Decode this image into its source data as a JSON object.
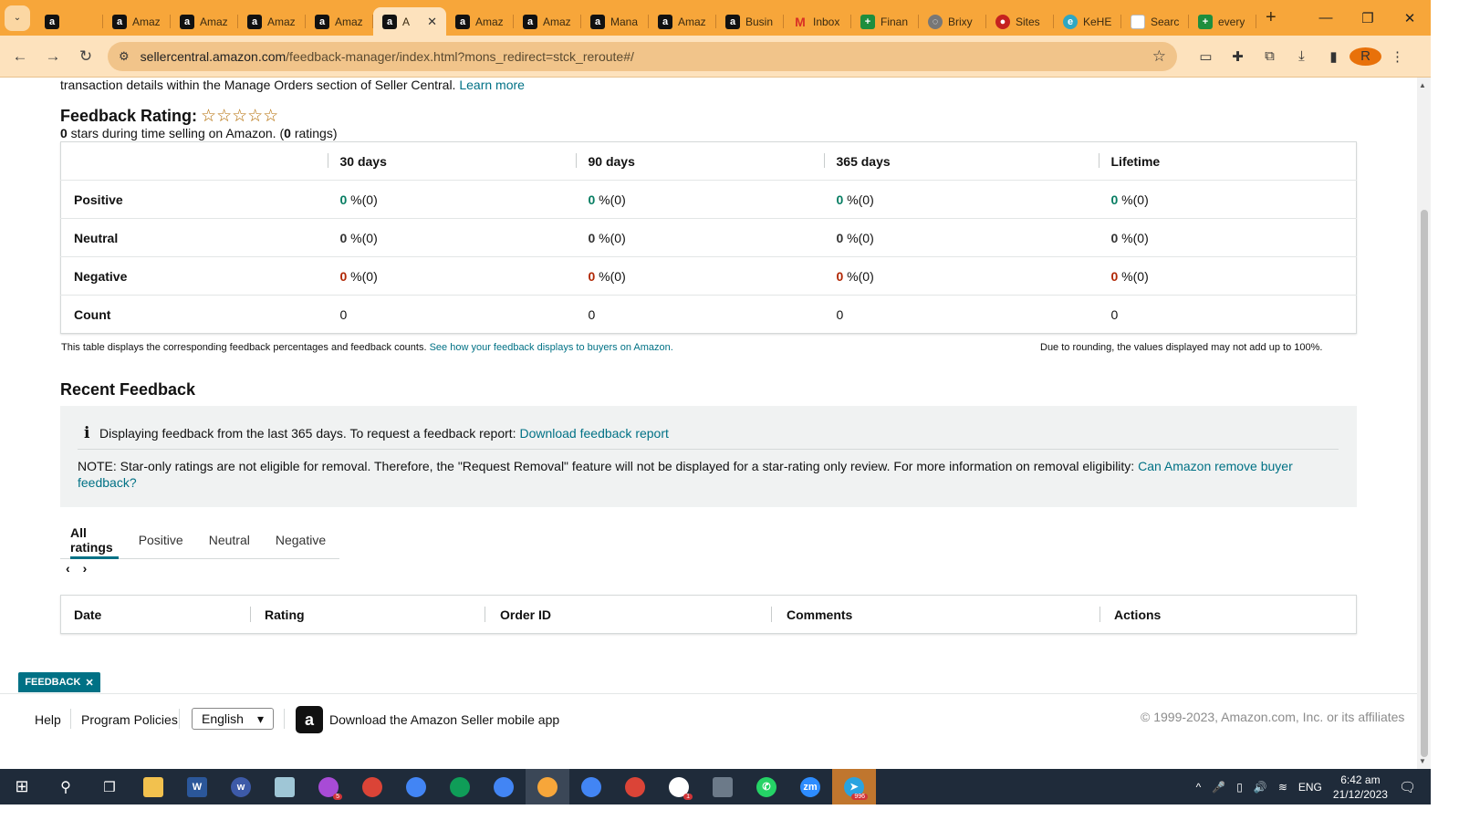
{
  "browser": {
    "tabs": [
      {
        "title": "",
        "icon": "amazon-icon",
        "active": false
      },
      {
        "title": "Amaz",
        "icon": "amazon-icon",
        "active": false
      },
      {
        "title": "Amaz",
        "icon": "amazon-icon",
        "active": false
      },
      {
        "title": "Amaz",
        "icon": "amazon-icon",
        "active": false
      },
      {
        "title": "Amaz",
        "icon": "amazon-icon",
        "active": false
      },
      {
        "title": "A",
        "icon": "amazon-icon",
        "active": true
      },
      {
        "title": "Amaz",
        "icon": "amazon-icon",
        "active": false
      },
      {
        "title": "Amaz",
        "icon": "amazon-icon",
        "active": false
      },
      {
        "title": "Mana",
        "icon": "amazon-icon",
        "active": false
      },
      {
        "title": "Amaz",
        "icon": "amazon-icon",
        "active": false
      },
      {
        "title": "Busin",
        "icon": "amazon-icon",
        "active": false
      },
      {
        "title": "Inbox",
        "icon": "gmail-icon",
        "active": false
      },
      {
        "title": "Finan",
        "icon": "sheets-icon",
        "active": false
      },
      {
        "title": "Brixy",
        "icon": "globe-icon",
        "active": false
      },
      {
        "title": "Sites",
        "icon": "site-icon",
        "active": false
      },
      {
        "title": "KeHE",
        "icon": "edge-icon",
        "active": false
      },
      {
        "title": "Searc",
        "icon": "page-icon",
        "active": false
      },
      {
        "title": "every",
        "icon": "sheets-icon",
        "active": false
      }
    ],
    "url_host": "sellercentral.amazon.com",
    "url_path": "/feedback-manager/index.html?mons_redirect=stck_reroute#/",
    "profile_initial": "R"
  },
  "intro": {
    "text": "transaction details within the Manage Orders section of Seller Central. ",
    "link": "Learn more"
  },
  "rating": {
    "title": "Feedback Rating:",
    "stars": "☆☆☆☆☆",
    "summary_prefix": "0",
    "summary_mid": " stars during time selling on Amazon. (",
    "summary_count": "0",
    "summary_suffix": " ratings)"
  },
  "feedback_table": {
    "headers": [
      "",
      "30 days",
      "90 days",
      "365 days",
      "Lifetime"
    ],
    "rows": [
      {
        "label": "Positive",
        "cells": [
          {
            "v": "0",
            "u": " %(0)"
          },
          {
            "v": "0",
            "u": " %(0)"
          },
          {
            "v": "0",
            "u": " %(0)"
          },
          {
            "v": "0",
            "u": " %(0)"
          }
        ]
      },
      {
        "label": "Neutral",
        "cells": [
          {
            "v": "0",
            "u": " %(0)"
          },
          {
            "v": "0",
            "u": " %(0)"
          },
          {
            "v": "0",
            "u": " %(0)"
          },
          {
            "v": "0",
            "u": " %(0)"
          }
        ]
      },
      {
        "label": "Negative",
        "cells": [
          {
            "v": "0",
            "u": " %(0)"
          },
          {
            "v": "0",
            "u": " %(0)"
          },
          {
            "v": "0",
            "u": " %(0)"
          },
          {
            "v": "0",
            "u": " %(0)"
          }
        ]
      },
      {
        "label": "Count",
        "cells": [
          {
            "v": "",
            "u": "0"
          },
          {
            "v": "",
            "u": "0"
          },
          {
            "v": "",
            "u": "0"
          },
          {
            "v": "",
            "u": "0"
          }
        ]
      }
    ],
    "note_left": "This table displays the corresponding feedback percentages and feedback counts. ",
    "note_left_link": "See how your feedback displays to buyers on Amazon.",
    "note_right": "Due to rounding, the values displayed may not add up to 100%."
  },
  "recent": {
    "title": "Recent Feedback",
    "info_text": "Displaying feedback from the last 365 days. To request a feedback report: ",
    "info_link": "Download feedback report",
    "note_text": "NOTE: Star-only ratings are not eligible for removal. Therefore, the \"Request Removal\" feature will not be displayed for a star-rating only review. For more information on removal eligibility: ",
    "note_link": "Can Amazon remove buyer feedback?",
    "tabs": [
      "All ratings",
      "Positive",
      "Neutral",
      "Negative"
    ],
    "columns": [
      "Date",
      "Rating",
      "Order ID",
      "Comments",
      "Actions"
    ]
  },
  "footer": {
    "help": "Help",
    "policies": "Program Policies",
    "language": "English",
    "app": "Download the Amazon Seller mobile app",
    "copyright": "© 1999-2023, Amazon.com, Inc. or its affiliates",
    "feedback_badge": "FEEDBACK"
  },
  "taskbar": {
    "lang": "ENG",
    "time": "6:42 am",
    "date": "21/12/2023",
    "badges": {
      "ai": "5",
      "slack": "1",
      "telegram": "996"
    }
  },
  "colors": {
    "tab_bar": "#f7a63a",
    "toolbar": "#fde2bd",
    "link": "#007185",
    "positive": "#067d62",
    "negative": "#b12704"
  }
}
